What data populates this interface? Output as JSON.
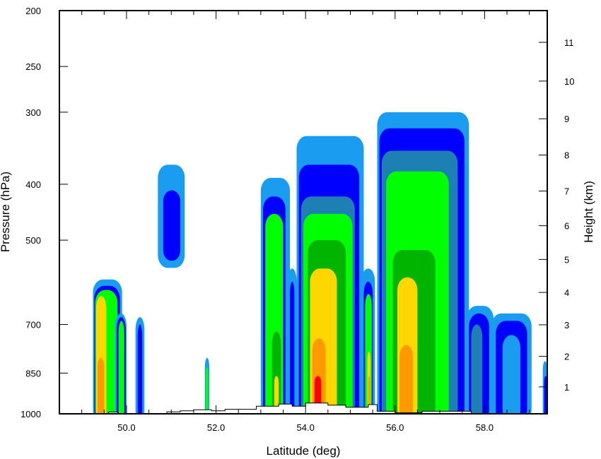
{
  "chart_data": {
    "type": "heatmap",
    "title": "",
    "xlabel": "Latitude (deg)",
    "ylabel": "Pressure (hPa)",
    "ylabel_right": "Height (km)",
    "xlim": [
      48.5,
      59.4
    ],
    "ylim": [
      1000,
      200
    ],
    "y_scale": "log",
    "x_ticks": [
      {
        "value": 50,
        "label": "50.0"
      },
      {
        "value": 52,
        "label": "52.0"
      },
      {
        "value": 54,
        "label": "54.0"
      },
      {
        "value": 56,
        "label": "56.0"
      },
      {
        "value": 58,
        "label": "58.0"
      }
    ],
    "y_ticks": [
      {
        "value": 200,
        "label": "200"
      },
      {
        "value": 250,
        "label": "250"
      },
      {
        "value": 300,
        "label": "300"
      },
      {
        "value": 400,
        "label": "400"
      },
      {
        "value": 500,
        "label": "500"
      },
      {
        "value": 700,
        "label": "700"
      },
      {
        "value": 850,
        "label": "850"
      },
      {
        "value": 1000,
        "label": "1000"
      }
    ],
    "height_ticks": [
      {
        "value": 1,
        "label": "1",
        "pressure": 898
      },
      {
        "value": 2,
        "label": "2",
        "pressure": 795
      },
      {
        "value": 3,
        "label": "3",
        "pressure": 701
      },
      {
        "value": 4,
        "label": "4",
        "pressure": 616
      },
      {
        "value": 5,
        "label": "5",
        "pressure": 540
      },
      {
        "value": 6,
        "label": "6",
        "pressure": 472
      },
      {
        "value": 7,
        "label": "7",
        "pressure": 411
      },
      {
        "value": 8,
        "label": "8",
        "pressure": 356
      },
      {
        "value": 9,
        "label": "9",
        "pressure": 308
      },
      {
        "value": 10,
        "label": "10",
        "pressure": 265
      },
      {
        "value": 11,
        "label": "11",
        "pressure": 227
      }
    ],
    "color_levels": [
      "#1a9cf0",
      "#0000ff",
      "#1e7fb5",
      "#00ff00",
      "#00b400",
      "#ffd700",
      "#ff9900",
      "#ff0000"
    ],
    "cells": [
      {
        "lat": [
          49.25,
          49.9
        ],
        "p": [
          1000,
          585
        ],
        "levels": [
          [
            49.25,
            49.9,
            585,
            1000,
            0
          ],
          [
            49.28,
            49.85,
            600,
            1000,
            1
          ],
          [
            49.3,
            49.8,
            610,
            1000,
            3
          ],
          [
            49.32,
            49.55,
            625,
            1000,
            5
          ],
          [
            49.35,
            49.5,
            800,
            1000,
            6
          ]
        ]
      },
      {
        "lat": [
          49.75,
          50.0
        ],
        "p": [
          1000,
          670
        ],
        "levels": [
          [
            49.75,
            50.0,
            670,
            1000,
            0
          ],
          [
            49.78,
            49.98,
            680,
            1000,
            1
          ],
          [
            49.82,
            49.95,
            690,
            1000,
            3
          ]
        ]
      },
      {
        "lat": [
          50.2,
          50.4
        ],
        "p": [
          1000,
          680
        ],
        "levels": [
          [
            50.2,
            50.4,
            680,
            1000,
            0
          ],
          [
            50.25,
            50.35,
            700,
            1000,
            1
          ]
        ]
      },
      {
        "lat": [
          50.7,
          51.3
        ],
        "p": [
          540,
          370
        ],
        "levels": [
          [
            50.7,
            51.3,
            370,
            540,
            0
          ],
          [
            50.82,
            51.2,
            410,
            525,
            1
          ]
        ]
      },
      {
        "lat": [
          51.75,
          51.85
        ],
        "p": [
          1000,
          800
        ],
        "levels": [
          [
            51.75,
            51.85,
            800,
            1000,
            0
          ],
          [
            51.77,
            51.83,
            830,
            1000,
            3
          ]
        ]
      },
      {
        "lat": [
          53.0,
          53.65
        ],
        "p": [
          1000,
          390
        ],
        "levels": [
          [
            53.0,
            53.65,
            390,
            1000,
            0
          ],
          [
            53.05,
            53.55,
            420,
            1000,
            1
          ],
          [
            53.1,
            53.5,
            450,
            1000,
            3
          ],
          [
            53.25,
            53.45,
            720,
            1000,
            4
          ],
          [
            53.3,
            53.4,
            860,
            1000,
            5
          ]
        ]
      },
      {
        "lat": [
          53.6,
          53.8
        ],
        "p": [
          1000,
          560
        ],
        "levels": [
          [
            53.6,
            53.8,
            560,
            1000,
            0
          ],
          [
            53.65,
            53.75,
            590,
            1000,
            1
          ]
        ]
      },
      {
        "lat": [
          53.8,
          55.3
        ],
        "p": [
          1000,
          330
        ],
        "levels": [
          [
            53.8,
            55.3,
            330,
            1000,
            0
          ],
          [
            53.85,
            55.2,
            370,
            1000,
            1
          ],
          [
            53.9,
            55.1,
            420,
            1000,
            2
          ],
          [
            53.95,
            55.05,
            450,
            1000,
            3
          ],
          [
            54.05,
            54.9,
            500,
            1000,
            4
          ],
          [
            54.1,
            54.7,
            560,
            1000,
            5
          ],
          [
            54.15,
            54.45,
            740,
            1000,
            6
          ],
          [
            54.2,
            54.35,
            860,
            1000,
            7
          ]
        ]
      },
      {
        "lat": [
          55.25,
          55.55
        ],
        "p": [
          1000,
          560
        ],
        "levels": [
          [
            55.25,
            55.55,
            560,
            1000,
            0
          ],
          [
            55.3,
            55.5,
            590,
            1000,
            1
          ],
          [
            55.33,
            55.48,
            620,
            1000,
            3
          ],
          [
            55.38,
            55.45,
            780,
            1000,
            5
          ],
          [
            55.4,
            55.44,
            860,
            1000,
            6
          ]
        ]
      },
      {
        "lat": [
          55.6,
          57.65
        ],
        "p": [
          1000,
          300
        ],
        "levels": [
          [
            55.6,
            57.65,
            300,
            1000,
            0
          ],
          [
            55.65,
            57.55,
            320,
            1000,
            1
          ],
          [
            55.7,
            57.4,
            350,
            1000,
            2
          ],
          [
            55.8,
            57.2,
            380,
            1000,
            3
          ],
          [
            55.95,
            56.9,
            520,
            1000,
            4
          ],
          [
            56.05,
            56.5,
            580,
            1000,
            5
          ],
          [
            56.1,
            56.4,
            760,
            1000,
            6
          ]
        ]
      },
      {
        "lat": [
          57.6,
          58.2
        ],
        "p": [
          1000,
          650
        ],
        "levels": [
          [
            57.6,
            58.2,
            650,
            1000,
            0
          ],
          [
            57.65,
            58.1,
            670,
            1000,
            1
          ],
          [
            57.7,
            57.95,
            700,
            1000,
            2
          ]
        ]
      },
      {
        "lat": [
          58.15,
          59.05
        ],
        "p": [
          1000,
          670
        ],
        "levels": [
          [
            58.15,
            59.05,
            670,
            1000,
            0
          ],
          [
            58.25,
            58.95,
            690,
            1000,
            1
          ],
          [
            58.4,
            58.8,
            730,
            1000,
            0
          ]
        ]
      },
      {
        "lat": [
          59.3,
          59.4
        ],
        "p": [
          1000,
          810
        ],
        "levels": [
          [
            59.3,
            59.4,
            810,
            1000,
            0
          ],
          [
            59.33,
            59.4,
            860,
            1000,
            1
          ]
        ]
      }
    ],
    "terrain": [
      [
        49.6,
        1000
      ],
      [
        49.6,
        993
      ],
      [
        49.8,
        993
      ],
      [
        49.8,
        1000
      ],
      [
        50.9,
        1000
      ],
      [
        50.9,
        992
      ],
      [
        51.2,
        992
      ],
      [
        51.2,
        988
      ],
      [
        51.5,
        988
      ],
      [
        51.5,
        984
      ],
      [
        51.9,
        984
      ],
      [
        51.9,
        988
      ],
      [
        52.2,
        988
      ],
      [
        52.2,
        982
      ],
      [
        52.9,
        982
      ],
      [
        52.9,
        970
      ],
      [
        53.4,
        970
      ],
      [
        53.4,
        962
      ],
      [
        53.7,
        962
      ],
      [
        53.7,
        970
      ],
      [
        54.0,
        970
      ],
      [
        54.0,
        958
      ],
      [
        54.5,
        958
      ],
      [
        54.5,
        966
      ],
      [
        54.9,
        966
      ],
      [
        54.9,
        974
      ],
      [
        55.4,
        974
      ],
      [
        55.4,
        964
      ],
      [
        55.6,
        964
      ],
      [
        55.6,
        990
      ],
      [
        56.0,
        990
      ],
      [
        56.0,
        996
      ],
      [
        56.6,
        996
      ],
      [
        56.6,
        990
      ],
      [
        57.7,
        990
      ],
      [
        57.7,
        1000
      ]
    ]
  }
}
